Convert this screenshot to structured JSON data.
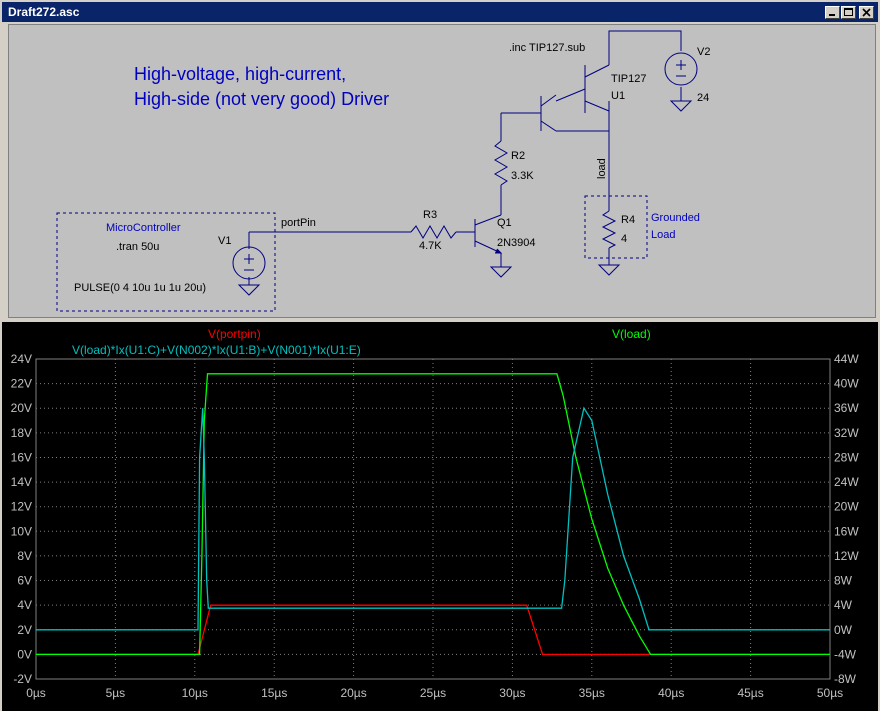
{
  "window": {
    "title": "Draft272.asc"
  },
  "schematic": {
    "headline_1": "High-voltage, high-current,",
    "headline_2": "High-side (not very good) Driver",
    "include_directive": ".inc TIP127.sub",
    "tran_directive": ".tran 50u",
    "pulse_spec": "PULSE(0 4 10u 1u 1u 20u)",
    "microcontroller_label": "MicroController",
    "grounded_load_label_1": "Grounded",
    "grounded_load_label_2": "Load",
    "net_portpin": "portPin",
    "net_load": "load",
    "components": {
      "u1": {
        "model": "TIP127",
        "ref": "U1"
      },
      "v2": {
        "ref": "V2",
        "value": "24"
      },
      "r2": {
        "ref": "R2",
        "value": "3.3K"
      },
      "r3": {
        "ref": "R3",
        "value": "4.7K"
      },
      "q1": {
        "ref": "Q1",
        "model": "2N3904"
      },
      "r4": {
        "ref": "R4",
        "value": "4"
      },
      "v1": {
        "ref": "V1"
      }
    }
  },
  "waveform": {
    "trace_red_label": "V(portpin)",
    "trace_green_label": "V(load)",
    "trace_cyan_label": "V(load)*Ix(U1:C)+V(N002)*Ix(U1:B)+V(N001)*Ix(U1:E)",
    "y_left_ticks": [
      "24V",
      "22V",
      "20V",
      "18V",
      "16V",
      "14V",
      "12V",
      "10V",
      "8V",
      "6V",
      "4V",
      "2V",
      "0V",
      "-2V"
    ],
    "y_right_ticks": [
      "44W",
      "40W",
      "36W",
      "32W",
      "28W",
      "24W",
      "20W",
      "16W",
      "12W",
      "8W",
      "4W",
      "0W",
      "-4W",
      "-8W"
    ],
    "x_ticks": [
      "0µs",
      "5µs",
      "10µs",
      "15µs",
      "20µs",
      "25µs",
      "30µs",
      "35µs",
      "40µs",
      "45µs",
      "50µs"
    ],
    "colors": {
      "portpin": "#ff0000",
      "load": "#00ff00",
      "power": "#00c0c0",
      "grid": "#808080"
    }
  },
  "chart_data": {
    "type": "line",
    "xlabel": "",
    "xlim": [
      0,
      50
    ],
    "ylim_left": [
      -2,
      24
    ],
    "ylim_right": [
      -8,
      44
    ],
    "grid": true,
    "series": [
      {
        "name": "V(portpin)",
        "axis": "left",
        "x": [
          0,
          10,
          10.2,
          11,
          30.9,
          31.9,
          50
        ],
        "values": [
          0,
          0,
          0,
          4,
          4,
          0,
          0
        ]
      },
      {
        "name": "V(load)",
        "axis": "left",
        "x": [
          0,
          10.3,
          10.45,
          10.6,
          10.8,
          32.8,
          33.2,
          34,
          35,
          36,
          37,
          38,
          38.7,
          50
        ],
        "values": [
          0,
          0,
          8,
          19,
          22.8,
          22.8,
          21,
          16,
          11,
          7,
          4,
          1.5,
          0,
          0
        ]
      },
      {
        "name": "V(load)*Ix(U1:C)+V(N002)*Ix(U1:B)+V(N001)*Ix(U1:E)",
        "axis": "right",
        "x": [
          0,
          10.2,
          10.3,
          10.5,
          10.6,
          10.75,
          10.85,
          33.1,
          33.3,
          33.8,
          34.5,
          35,
          36,
          37,
          38,
          38.6,
          50
        ],
        "values": [
          0,
          0,
          28,
          36,
          28,
          8,
          3.5,
          3.5,
          8,
          28,
          36,
          34,
          22,
          12,
          5,
          0,
          0
        ]
      }
    ]
  }
}
